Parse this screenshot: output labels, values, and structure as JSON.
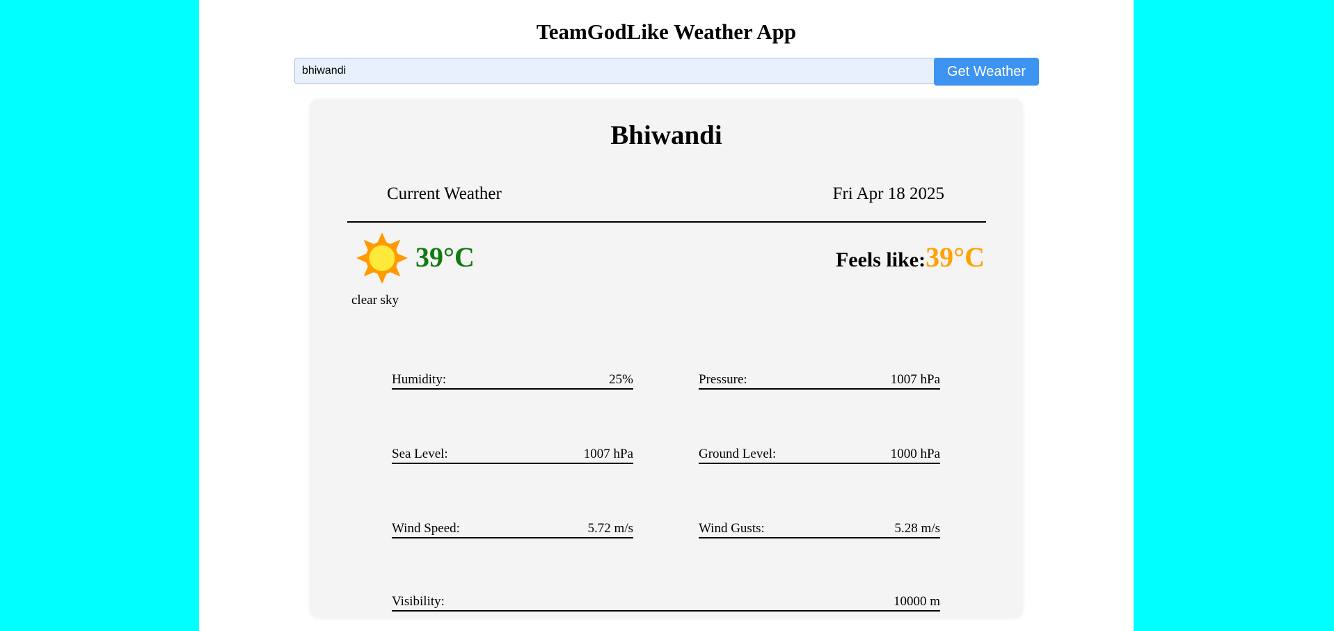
{
  "app": {
    "title": "TeamGodLike Weather App"
  },
  "search": {
    "value": "bhiwandi",
    "button_label": "Get Weather"
  },
  "weather": {
    "city": "Bhiwandi",
    "section_label": "Current Weather",
    "date": "Fri Apr 18 2025",
    "icon": "sun-icon",
    "temperature": "39°C",
    "condition": "clear sky",
    "feels_like_label": "Feels like:",
    "feels_like_value": "39°C"
  },
  "stats": {
    "humidity": {
      "label": "Humidity:",
      "value": "25%"
    },
    "pressure": {
      "label": "Pressure:",
      "value": "1007 hPa"
    },
    "sea_level": {
      "label": "Sea Level:",
      "value": "1007 hPa"
    },
    "ground_level": {
      "label": "Ground Level:",
      "value": "1000 hPa"
    },
    "wind_speed": {
      "label": "Wind Speed:",
      "value": "5.72 m/s"
    },
    "wind_gusts": {
      "label": "Wind Gusts:",
      "value": "5.28 m/s"
    },
    "visibility": {
      "label": "Visibility:",
      "value": "10000 m"
    }
  },
  "colors": {
    "background": "#00ffff",
    "button": "#3d94f0",
    "temperature": "#117a11",
    "feels_like": "#ffa200"
  }
}
